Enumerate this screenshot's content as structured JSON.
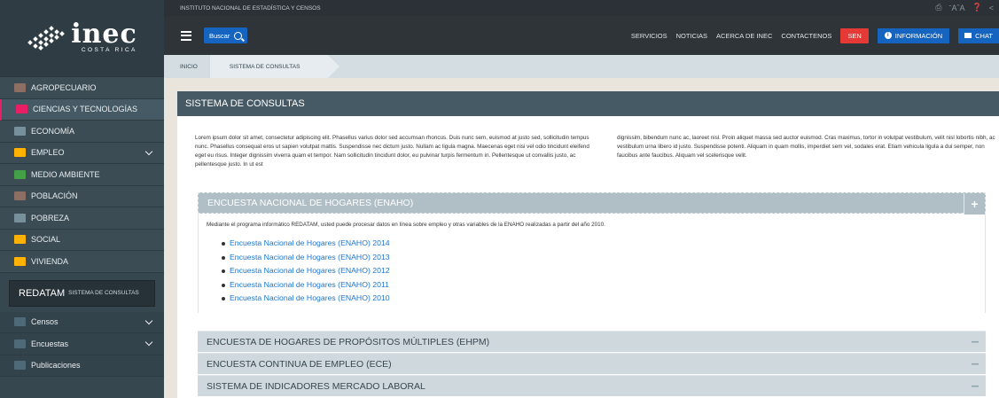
{
  "brand": {
    "name": "inec",
    "subtitle": "COSTA RICA"
  },
  "sidebar": {
    "items": [
      {
        "label": "AGROPECUARIO",
        "icon": "tractor-icon",
        "color": "#8d6e63"
      },
      {
        "label": "CIENCIAS Y TECNOLOGÍAS",
        "icon": "laptop-icon",
        "color": "#e91e63"
      },
      {
        "label": "ECONOMÍA",
        "icon": "money-icon",
        "color": "#78909c"
      },
      {
        "label": "EMPLEO",
        "icon": "briefcase-icon",
        "color": "#ffb300"
      },
      {
        "label": "MEDIO AMBIENTE",
        "icon": "tree-icon",
        "color": "#43a047"
      },
      {
        "label": "POBLACIÓN",
        "icon": "people-icon",
        "color": "#8d6e63"
      },
      {
        "label": "POBREZA",
        "icon": "poverty-icon",
        "color": "#78909c"
      },
      {
        "label": "SOCIAL",
        "icon": "social-icon",
        "color": "#ffb300"
      },
      {
        "label": "VIVIENDA",
        "icon": "house-icon",
        "color": "#ffb300"
      }
    ],
    "redatam": {
      "label": "REDATAM",
      "sub": "SISTEMA DE CONSULTAS"
    },
    "bottom": [
      {
        "label": "Censos",
        "icon": "census-icon"
      },
      {
        "label": "Encuestas",
        "icon": "survey-icon"
      },
      {
        "label": "Publicaciones",
        "icon": "document-icon"
      }
    ]
  },
  "topbar": {
    "title": "INSTITUTO NACIONAL DE ESTADÍSTICA Y CENSOS",
    "font_controls": "ˉAˆA"
  },
  "navbar": {
    "search_label": "Buscar",
    "links": [
      "SERVICIOS",
      "NOTICIAS",
      "ACERCA DE INEC",
      "CONTACTENOS"
    ],
    "sen_label": "SEN",
    "info_label": "INFORMACIÓN",
    "chat_label": "CHAT"
  },
  "breadcrumb": {
    "home": "INICIO",
    "current": "SISTEMA DE CONSULTAS"
  },
  "main": {
    "section_title": "SISTEMA DE CONSULTAS",
    "intro_left": "Lorem ipsum dolor sit amet, consectetur adipiscing elit. Phasellus varius dolor sed accumsan rhoncus. Duis nunc sem, euismod at justo sed, sollicitudin tempus nunc. Phasellus consequat eros ut sapien volutpat mattis. Suspendisse nec dictum justo. Nullam ac ligula magna. Maecenas eget nisi vel odio tincidunt eleifend eget eu risus. Integer dignissim viverra quam et tempor. Nam sollicitudin tincidunt dolor, eu pulvinar turpis fermentum in. Pellentesque ut convallis justo, ac pellentesque justo. In ut est",
    "intro_right": "dignissim, bibendum nunc ac, laoreet nisl. Proin aliquet massa sed auctor euismod. Cras maximus, tortor in volutpat vestibulum, velit nisl lobortis nibh, ac vestibulum urna libero id justo. Suspendisse potenti. Aliquam in quam mollis, imperdiet sem vel, sodales erat. Etiam vehicula ligula a dui semper, non faucibus ante faucibus. Aliquam vel scelerisque velit.",
    "accordion": {
      "open": {
        "title": "ENCUESTA NACIONAL DE HOGARES (ENAHO)",
        "toggle": "+",
        "description": "Mediante el programa informático REDATAM, usted puede procesar datos en línea sobre empleo y otras variables de la ENAHO realizadas a partir del año 2010.",
        "links": [
          "Encuesta Nacional de Hogares (ENAHO) 2014",
          "Encuesta Nacional de Hogares (ENAHO) 2013",
          "Encuesta Nacional de Hogares (ENAHO) 2012",
          "Encuesta Nacional de Hogares (ENAHO) 2011",
          "Encuesta Nacional de Hogares (ENAHO) 2010"
        ]
      },
      "closed": [
        {
          "title": "ENCUESTA DE HOGARES DE PROPÓSITOS MÚLTIPLES (EHPM)",
          "toggle": "–"
        },
        {
          "title": "ENCUESTA CONTINUA DE EMPLEO (ECE)",
          "toggle": "–"
        },
        {
          "title": "SISTEMA DE INDICADORES MERCADO LABORAL",
          "toggle": "–"
        }
      ]
    }
  }
}
